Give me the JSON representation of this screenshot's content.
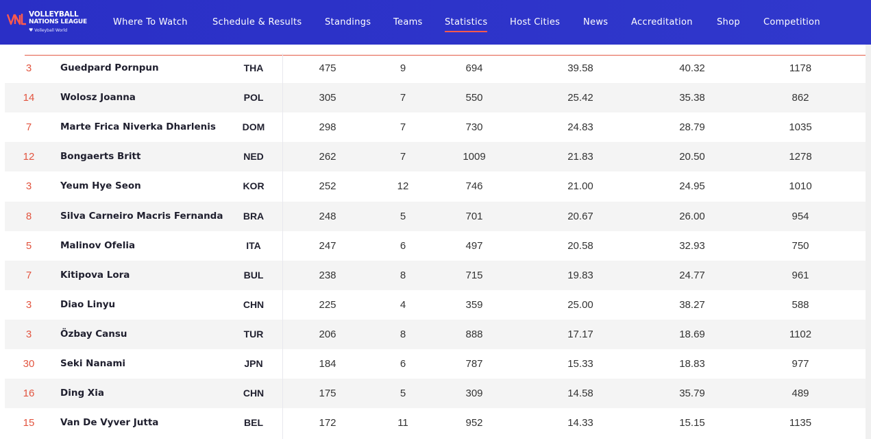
{
  "logo": {
    "line1": "VOLLEYBALL",
    "line2": "NATIONS LEAGUE",
    "sub": "Volleyball World"
  },
  "nav": {
    "items": [
      {
        "label": "Where To Watch"
      },
      {
        "label": "Schedule & Results"
      },
      {
        "label": "Standings"
      },
      {
        "label": "Teams"
      },
      {
        "label": "Statistics"
      },
      {
        "label": "Host Cities"
      },
      {
        "label": "News"
      },
      {
        "label": "Accreditation"
      },
      {
        "label": "Shop"
      },
      {
        "label": "Competition"
      }
    ],
    "active": "Statistics"
  },
  "colors": {
    "nav_bg": "#2b30c8",
    "accent": "#e2543f",
    "row_alt": "#f4f4f4"
  },
  "rows": [
    {
      "num": "3",
      "name": "Guedpard Pornpun",
      "team": "THA",
      "v1": "475",
      "v2": "9",
      "v3": "694",
      "v4": "39.58",
      "v5": "40.32",
      "v6": "1178"
    },
    {
      "num": "14",
      "name": "Wolosz Joanna",
      "team": "POL",
      "v1": "305",
      "v2": "7",
      "v3": "550",
      "v4": "25.42",
      "v5": "35.38",
      "v6": "862"
    },
    {
      "num": "7",
      "name": "Marte Frica Niverka Dharlenis",
      "team": "DOM",
      "v1": "298",
      "v2": "7",
      "v3": "730",
      "v4": "24.83",
      "v5": "28.79",
      "v6": "1035"
    },
    {
      "num": "12",
      "name": "Bongaerts Britt",
      "team": "NED",
      "v1": "262",
      "v2": "7",
      "v3": "1009",
      "v4": "21.83",
      "v5": "20.50",
      "v6": "1278"
    },
    {
      "num": "3",
      "name": "Yeum Hye Seon",
      "team": "KOR",
      "v1": "252",
      "v2": "12",
      "v3": "746",
      "v4": "21.00",
      "v5": "24.95",
      "v6": "1010"
    },
    {
      "num": "8",
      "name": "Silva Carneiro Macris Fernanda",
      "team": "BRA",
      "v1": "248",
      "v2": "5",
      "v3": "701",
      "v4": "20.67",
      "v5": "26.00",
      "v6": "954"
    },
    {
      "num": "5",
      "name": "Malinov Ofelia",
      "team": "ITA",
      "v1": "247",
      "v2": "6",
      "v3": "497",
      "v4": "20.58",
      "v5": "32.93",
      "v6": "750"
    },
    {
      "num": "7",
      "name": "Kitipova Lora",
      "team": "BUL",
      "v1": "238",
      "v2": "8",
      "v3": "715",
      "v4": "19.83",
      "v5": "24.77",
      "v6": "961"
    },
    {
      "num": "3",
      "name": "Diao Linyu",
      "team": "CHN",
      "v1": "225",
      "v2": "4",
      "v3": "359",
      "v4": "25.00",
      "v5": "38.27",
      "v6": "588"
    },
    {
      "num": "3",
      "name": "Özbay Cansu",
      "team": "TUR",
      "v1": "206",
      "v2": "8",
      "v3": "888",
      "v4": "17.17",
      "v5": "18.69",
      "v6": "1102"
    },
    {
      "num": "30",
      "name": "Seki Nanami",
      "team": "JPN",
      "v1": "184",
      "v2": "6",
      "v3": "787",
      "v4": "15.33",
      "v5": "18.83",
      "v6": "977"
    },
    {
      "num": "16",
      "name": "Ding Xia",
      "team": "CHN",
      "v1": "175",
      "v2": "5",
      "v3": "309",
      "v4": "14.58",
      "v5": "35.79",
      "v6": "489"
    },
    {
      "num": "15",
      "name": "Van De Vyver Jutta",
      "team": "BEL",
      "v1": "172",
      "v2": "11",
      "v3": "952",
      "v4": "14.33",
      "v5": "15.15",
      "v6": "1135"
    }
  ]
}
